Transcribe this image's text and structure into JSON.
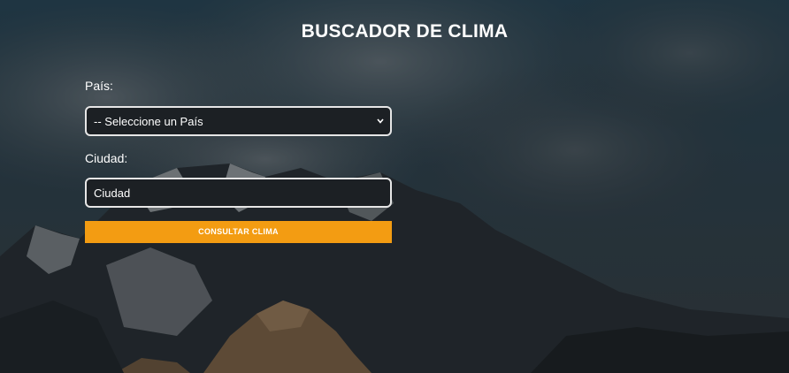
{
  "header": {
    "title": "BUSCADOR DE CLIMA"
  },
  "form": {
    "country_label": "País:",
    "country_select": {
      "selected": "-- Seleccione un País"
    },
    "city_label": "Ciudad:",
    "city_input": {
      "placeholder": "Ciudad",
      "value": ""
    },
    "submit_label": "CONSULTAR CLIMA"
  },
  "colors": {
    "accent": "#f39c12",
    "text": "#ffffff",
    "field_border": "#e6e6e6"
  }
}
